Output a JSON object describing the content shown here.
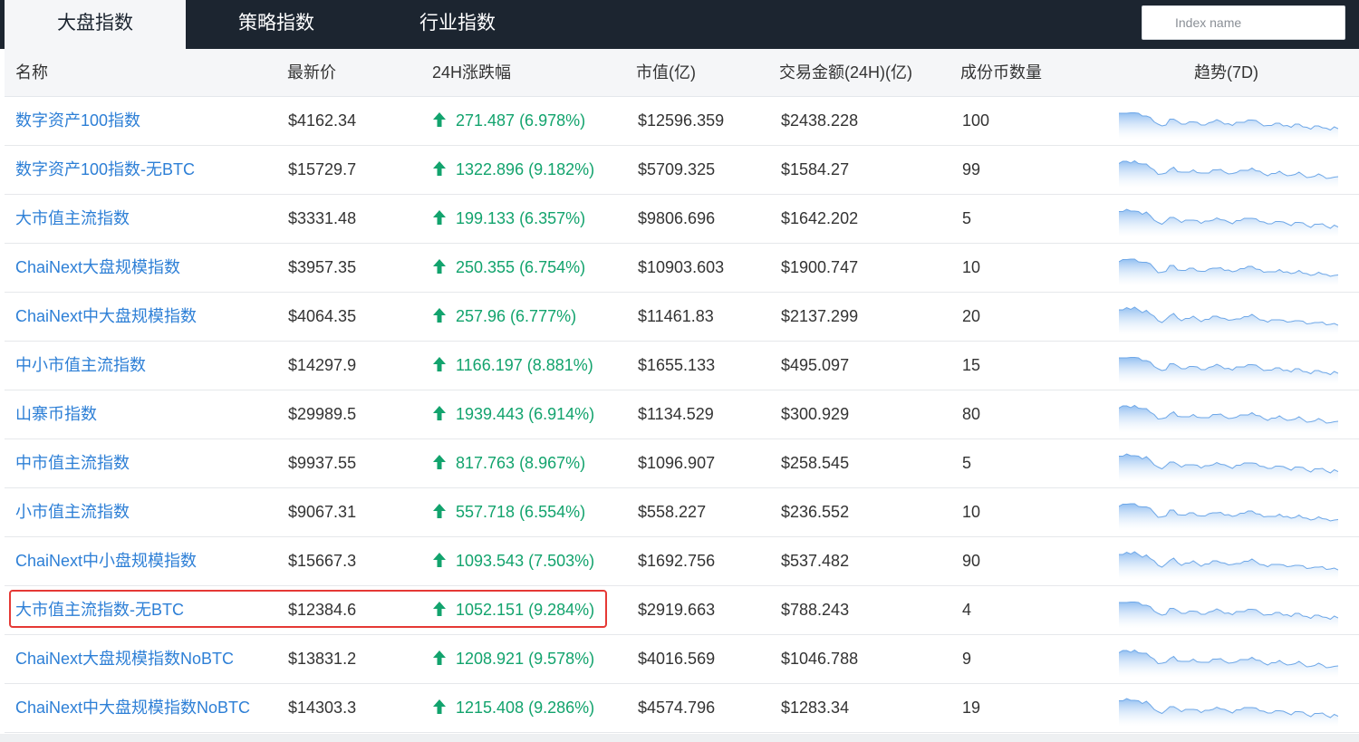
{
  "tabs": [
    "大盘指数",
    "策略指数",
    "行业指数"
  ],
  "search": {
    "placeholder": "Index name"
  },
  "columns": [
    "名称",
    "最新价",
    "24H涨跌幅",
    "市值(亿)",
    "交易金额(24H)(亿)",
    "成份币数量",
    "趋势(7D)"
  ],
  "rows": [
    {
      "name": "数字资产100指数",
      "price": "$4162.34",
      "change": "271.487 (6.978%)",
      "cap": "$12596.359",
      "volume": "$2438.228",
      "count": "100"
    },
    {
      "name": "数字资产100指数-无BTC",
      "price": "$15729.7",
      "change": "1322.896 (9.182%)",
      "cap": "$5709.325",
      "volume": "$1584.27",
      "count": "99"
    },
    {
      "name": "大市值主流指数",
      "price": "$3331.48",
      "change": "199.133 (6.357%)",
      "cap": "$9806.696",
      "volume": "$1642.202",
      "count": "5"
    },
    {
      "name": "ChaiNext大盘规模指数",
      "price": "$3957.35",
      "change": "250.355 (6.754%)",
      "cap": "$10903.603",
      "volume": "$1900.747",
      "count": "10"
    },
    {
      "name": "ChaiNext中大盘规模指数",
      "price": "$4064.35",
      "change": "257.96 (6.777%)",
      "cap": "$11461.83",
      "volume": "$2137.299",
      "count": "20"
    },
    {
      "name": "中小市值主流指数",
      "price": "$14297.9",
      "change": "1166.197 (8.881%)",
      "cap": "$1655.133",
      "volume": "$495.097",
      "count": "15"
    },
    {
      "name": "山寨币指数",
      "price": "$29989.5",
      "change": "1939.443 (6.914%)",
      "cap": "$1134.529",
      "volume": "$300.929",
      "count": "80"
    },
    {
      "name": "中市值主流指数",
      "price": "$9937.55",
      "change": "817.763 (8.967%)",
      "cap": "$1096.907",
      "volume": "$258.545",
      "count": "5"
    },
    {
      "name": "小市值主流指数",
      "price": "$9067.31",
      "change": "557.718 (6.554%)",
      "cap": "$558.227",
      "volume": "$236.552",
      "count": "10"
    },
    {
      "name": "ChaiNext中小盘规模指数",
      "price": "$15667.3",
      "change": "1093.543 (7.503%)",
      "cap": "$1692.756",
      "volume": "$537.482",
      "count": "90"
    },
    {
      "name": "大市值主流指数-无BTC",
      "price": "$12384.6",
      "change": "1052.151 (9.284%)",
      "cap": "$2919.663",
      "volume": "$788.243",
      "count": "4"
    },
    {
      "name": "ChaiNext大盘规模指数NoBTC",
      "price": "$13831.2",
      "change": "1208.921 (9.578%)",
      "cap": "$4016.569",
      "volume": "$1046.788",
      "count": "9"
    },
    {
      "name": "ChaiNext中大盘规模指数NoBTC",
      "price": "$14303.3",
      "change": "1215.408 (9.286%)",
      "cap": "$4574.796",
      "volume": "$1283.34",
      "count": "19"
    }
  ],
  "colors": {
    "header_bg": "#1c2530",
    "link": "#2d7fd6",
    "up": "#12a36d",
    "highlight": "#e53935",
    "spark_line": "#6fa8e8"
  },
  "icons": {
    "change_arrow": "up-arrow-icon"
  }
}
